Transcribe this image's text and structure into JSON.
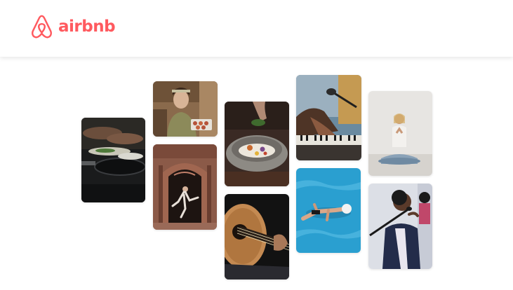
{
  "header": {
    "logo_text": "airbnb",
    "logo_icon": "airbnb-belo-icon",
    "brand_color": "#FF5A5F"
  },
  "gallery": {
    "images": [
      {
        "id": "cooking",
        "subject": "hands-cooking-in-pan",
        "icon": "photo"
      },
      {
        "id": "chef",
        "subject": "woman-holding-food-tray",
        "icon": "photo"
      },
      {
        "id": "dancer",
        "subject": "dancer-in-doorway",
        "icon": "photo"
      },
      {
        "id": "bowl",
        "subject": "plated-dish-in-stone-bowl",
        "icon": "photo"
      },
      {
        "id": "guitar",
        "subject": "acoustic-guitar-player",
        "icon": "photo"
      },
      {
        "id": "pianist",
        "subject": "hands-on-keyboard-with-microphone",
        "icon": "photo"
      },
      {
        "id": "swimmer",
        "subject": "swimmer-in-pool",
        "icon": "photo"
      },
      {
        "id": "yoga",
        "subject": "woman-meditating",
        "icon": "photo"
      },
      {
        "id": "singer",
        "subject": "singer-at-microphone",
        "icon": "photo"
      }
    ]
  }
}
